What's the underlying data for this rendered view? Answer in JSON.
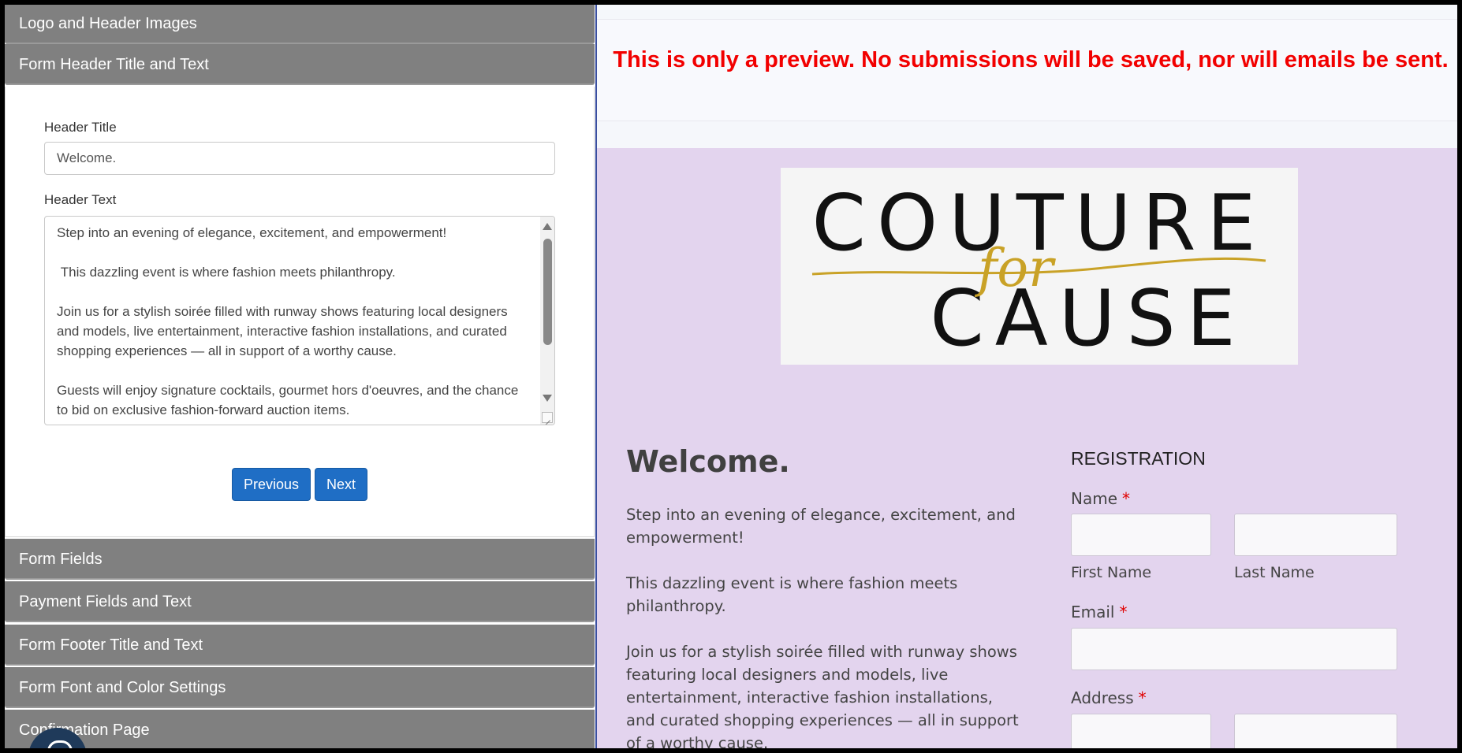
{
  "editor": {
    "sections": {
      "logo": "Logo and Header Images",
      "header": "Form Header Title and Text",
      "fields": "Form Fields",
      "payment": "Payment Fields and Text",
      "footer": "Form Footer Title and Text",
      "font": "Form Font and Color Settings",
      "confirmation": "Confirmation Page"
    },
    "header_title_label": "Header Title",
    "header_title_value": "Welcome.",
    "header_text_label": "Header Text",
    "header_text_value": "Step into an evening of elegance, excitement, and empowerment!\n\n This dazzling event is where fashion meets philanthropy.\n\nJoin us for a stylish soirée filled with runway shows featuring local designers and models, live entertainment, interactive fashion installations, and curated shopping experiences — all in support of a worthy cause.\n\nGuests will enjoy signature cocktails, gourmet hors d'oeuvres, and the chance to bid on exclusive fashion-forward auction items.",
    "previous_label": "Previous",
    "next_label": "Next"
  },
  "preview": {
    "notice": "This is only a preview. No submissions will be saved, nor will emails be sent.",
    "logo": {
      "top": "COUTURE",
      "middle": "for",
      "bottom": "CAUSE",
      "gold": "#c9a227"
    },
    "welcome": "Welcome.",
    "body": "Step into an evening of elegance, excitement, and empowerment!\n\nThis dazzling event is where fashion meets philanthropy.\n\nJoin us for a stylish soirée filled with runway shows featuring local designers and models, live entertainment, interactive fashion installations, and curated shopping experiences — all in support of a worthy cause.",
    "registration_title": "REGISTRATION",
    "name_label": "Name",
    "first_name_label": "First Name",
    "last_name_label": "Last Name",
    "email_label": "Email",
    "address_label": "Address",
    "required_mark": "*"
  },
  "colors": {
    "panel_header": "#808080",
    "button": "#1f6ec5",
    "notice": "#f20000",
    "form_background": "#e3d4ee"
  }
}
